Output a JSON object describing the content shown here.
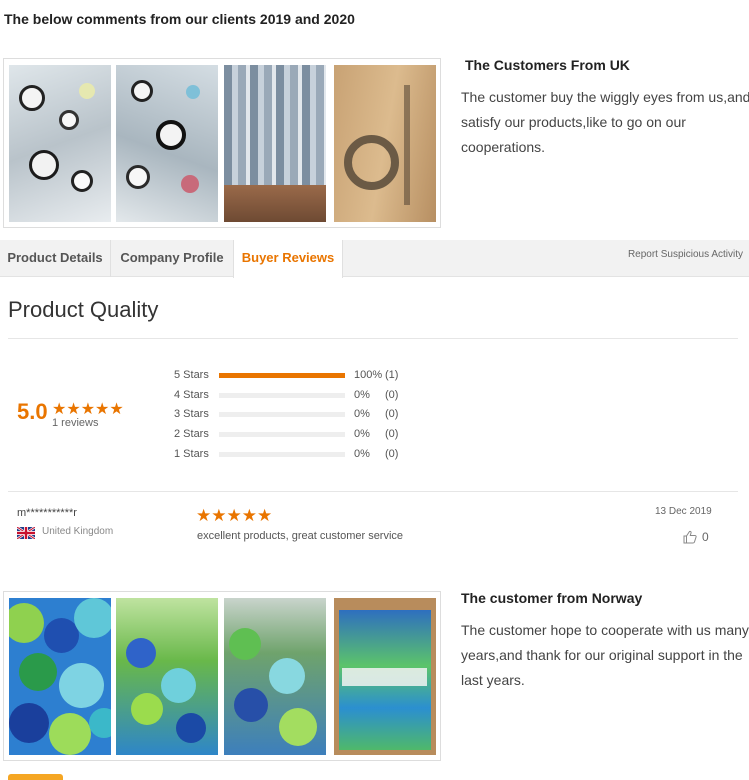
{
  "heading": "The below comments from our clients 2019 and 2020",
  "customer_uk": {
    "title": "The Customers From UK",
    "text_lines": [
      "The customer buy the wiggly eyes from us,and",
      "satisfy our products,like to go on our",
      "cooperations."
    ],
    "photos": [
      "wiggly-eyes-bags-photo",
      "wiggly-eyes-bags-photo",
      "packed-bags-photo",
      "carton-box-photo"
    ]
  },
  "tabs": [
    {
      "label": "Product Details",
      "active": false
    },
    {
      "label": "Company Profile",
      "active": false
    },
    {
      "label": "Buyer Reviews",
      "active": true
    }
  ],
  "report_link": "Report Suspicious Activity",
  "product_quality": {
    "title": "Product Quality",
    "score": "5.0",
    "stars": "★★★★★",
    "reviews_label": "1 reviews",
    "breakdown": [
      {
        "label": "5 Stars",
        "fraction": 1.0,
        "pct": "100%",
        "count": "(1)"
      },
      {
        "label": "4 Stars",
        "fraction": 0,
        "pct": "0%",
        "count": "(0)"
      },
      {
        "label": "3 Stars",
        "fraction": 0,
        "pct": "0%",
        "count": "(0)"
      },
      {
        "label": "2 Stars",
        "fraction": 0,
        "pct": "0%",
        "count": "(0)"
      },
      {
        "label": "1 Stars",
        "fraction": 0,
        "pct": "0%",
        "count": "(0)"
      }
    ]
  },
  "review": {
    "reviewer": "m***********r",
    "country": "United Kingdom",
    "flag_icon": "uk-flag-icon",
    "stars": "★★★★★",
    "rating": 5,
    "text": "excellent products, great customer service",
    "date": "13 Dec 2019",
    "likes": "0"
  },
  "customer_norway": {
    "title": "The customer from Norway",
    "text_lines": [
      "The customer hope to cooperate with us many",
      "years,and thank for our original support in the",
      "last years."
    ],
    "photos": [
      "pompom-balls-photo",
      "pompom-bag-photo",
      "pompom-bag-photo",
      "pompom-carton-photo"
    ]
  },
  "colors": {
    "accent": "#e97500",
    "tab_bg": "#f2f2f2",
    "bar_bg": "#eeeeee"
  }
}
